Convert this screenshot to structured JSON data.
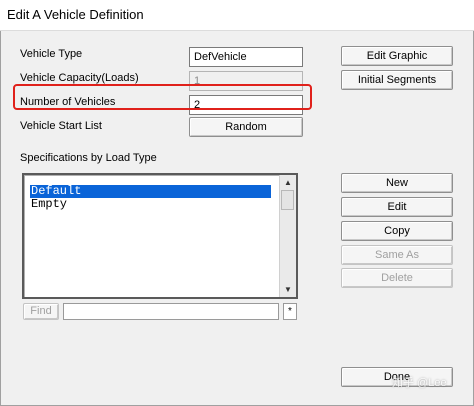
{
  "window": {
    "title": "Edit A Vehicle Definition"
  },
  "form": {
    "vehicle_type_label": "Vehicle Type",
    "vehicle_type_value": "DefVehicle",
    "vehicle_capacity_label": "Vehicle Capacity(Loads)",
    "vehicle_capacity_value": "1",
    "num_vehicles_label": "Number of Vehicles",
    "num_vehicles_value": "2",
    "start_list_label": "Vehicle Start List",
    "start_list_button": "Random"
  },
  "top_buttons": {
    "edit_graphic": "Edit Graphic",
    "initial_segments": "Initial Segments"
  },
  "specs": {
    "label": "Specifications by Load Type",
    "items": [
      "Default",
      "Empty"
    ],
    "selected_index": 0
  },
  "spec_buttons": {
    "new": "New",
    "edit": "Edit",
    "copy": "Copy",
    "same_as": "Same As",
    "delete": "Delete"
  },
  "find": {
    "button": "Find",
    "value": "",
    "star": "*"
  },
  "footer": {
    "done": "Done",
    "watermark": "知乎 @Lee"
  },
  "colors": {
    "highlight": "#e0211b",
    "selection": "#0a64d8"
  }
}
